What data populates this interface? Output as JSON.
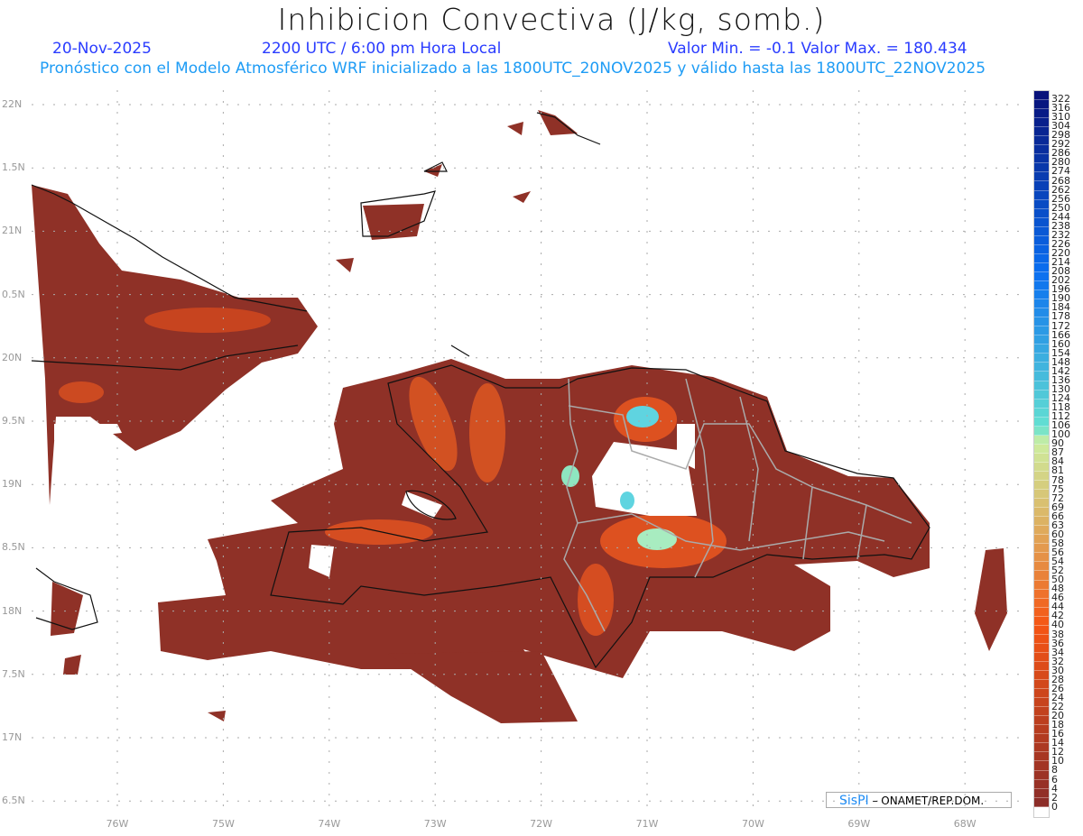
{
  "header": {
    "title": "Inhibicion Convectiva (J/kg, somb.)",
    "date": "20-Nov-2025",
    "time": "2200 UTC / 6:00 pm Hora Local",
    "minmax": "Valor Min. = -0.1  Valor Max. = 180.434",
    "subtitle": "Pronóstico con el Modelo Atmosférico WRF inicializado a las 1800UTC_20NOV2025 y válido hasta las  1800UTC_22NOV2025"
  },
  "axes": {
    "lat_labels": [
      "22N",
      "1.5N",
      "21N",
      "0.5N",
      "20N",
      "9.5N",
      "19N",
      "8.5N",
      "18N",
      "7.5N",
      "17N",
      "6.5N"
    ],
    "lon_labels": [
      "76W",
      "75W",
      "74W",
      "73W",
      "72W",
      "71W",
      "70W",
      "69W",
      "68W"
    ]
  },
  "colorbar": {
    "labels": [
      "322",
      "316",
      "310",
      "304",
      "298",
      "292",
      "286",
      "280",
      "274",
      "268",
      "262",
      "256",
      "250",
      "244",
      "238",
      "232",
      "226",
      "220",
      "214",
      "208",
      "202",
      "196",
      "190",
      "184",
      "178",
      "172",
      "166",
      "160",
      "154",
      "148",
      "142",
      "136",
      "130",
      "124",
      "118",
      "112",
      "106",
      "100",
      "90",
      "87",
      "84",
      "81",
      "78",
      "75",
      "72",
      "69",
      "66",
      "63",
      "60",
      "58",
      "56",
      "54",
      "52",
      "50",
      "48",
      "46",
      "44",
      "42",
      "40",
      "38",
      "36",
      "34",
      "32",
      "30",
      "28",
      "26",
      "24",
      "22",
      "20",
      "18",
      "16",
      "14",
      "12",
      "10",
      "8",
      "6",
      "4",
      "2",
      "0"
    ]
  },
  "colors": {
    "low": "#8f3127",
    "mid": "#e8521a",
    "high": "#cdeea0",
    "cyan": "#5fd4e0",
    "blue": "#08127a"
  },
  "credit": {
    "brand": "SisPI",
    "rest": " – ONAMET/REP.DOM."
  }
}
